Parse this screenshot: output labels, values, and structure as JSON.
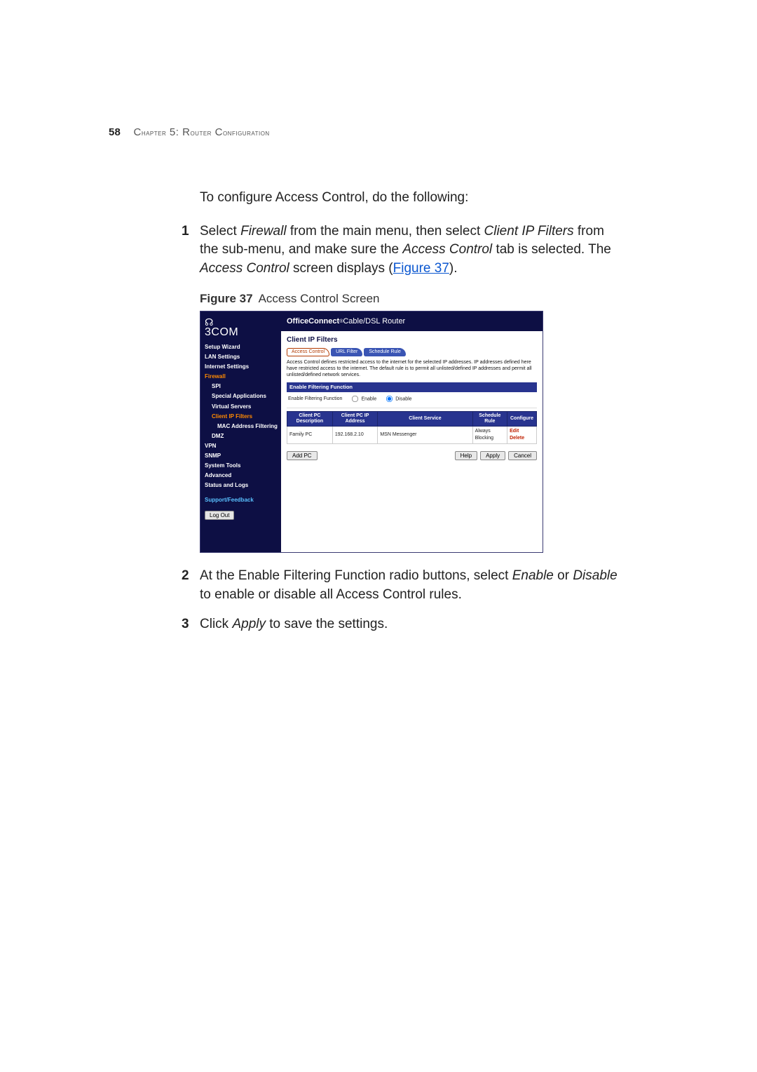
{
  "running_header": {
    "page_number": "58",
    "chapter_prefix": "C",
    "chapter_rest_sc": "hapter",
    "chapter_num": " 5: R",
    "title_rest_sc": "outer",
    "space": " C",
    "conf_rest_sc": "onfiguration"
  },
  "intro_paragraph": "To configure Access Control, do the following:",
  "steps": {
    "1": {
      "num": "1",
      "t1": "Select ",
      "i1": "Firewall",
      "t2": " from the main menu, then select ",
      "i2": "Client IP Filters",
      "t3": " from the sub-menu, and make sure the ",
      "i3": "Access Control",
      "t4": " tab is selected. The ",
      "i4": "Access Control",
      "t5": " screen displays (",
      "link": "Figure 37",
      "t6": ")."
    },
    "2": {
      "num": "2",
      "t1": "At the Enable Filtering Function radio buttons, select ",
      "i1": "Enable",
      "t2": " or ",
      "i2": "Disable",
      "t3": " to enable or disable all Access Control rules."
    },
    "3": {
      "num": "3",
      "t1": "Click ",
      "i1": "Apply",
      "t2": " to save the settings."
    }
  },
  "figure": {
    "label": "Figure 37",
    "caption": "Access Control Screen"
  },
  "router": {
    "brand": "3COM",
    "product_bold": "OfficeConnect",
    "product_sup": "®",
    "product_rest": " Cable/DSL Router",
    "nav": {
      "setup": "Setup Wizard",
      "lan": "LAN Settings",
      "inet": "Internet Settings",
      "fw": "Firewall",
      "spi": "SPI",
      "specapp": "Special Applications",
      "vserv": "Virtual Servers",
      "cip": "Client IP Filters",
      "macfilt": "MAC Address Filtering",
      "dmz": "DMZ",
      "vpn": "VPN",
      "snmp": "SNMP",
      "systools": "System Tools",
      "adv": "Advanced",
      "status": "Status and Logs",
      "feedback": "Support/Feedback",
      "logout": "Log Out"
    },
    "page_title": "Client IP Filters",
    "tabs": {
      "access": "Access Control",
      "url": "URL Filter",
      "sched": "Schedule Rule"
    },
    "description": "Access Control defines restricted access to the internet for the selected IP addresses. IP addresses defined here have restricted access to the internet. The default rule is to permit all unlisted/defined IP addresses and permit all unlisted/defined network services.",
    "enable_header": "Enable Filtering Function",
    "enable_label": "Enable Filtering Function",
    "radio_enable": "Enable",
    "radio_disable": "Disable",
    "grid_headers": {
      "desc": "Client PC Description",
      "ip": "Client PC IP Address",
      "svc": "Client Service",
      "sched": "Schedule Rule",
      "conf": "Configure"
    },
    "row": {
      "desc": "Family PC",
      "ip": "192.168.2.10",
      "svc": "MSN Messenger",
      "sched": "Always Blocking",
      "edit": "Edit",
      "del": "Delete"
    },
    "buttons": {
      "add": "Add PC",
      "help": "Help",
      "apply": "Apply",
      "cancel": "Cancel"
    }
  }
}
